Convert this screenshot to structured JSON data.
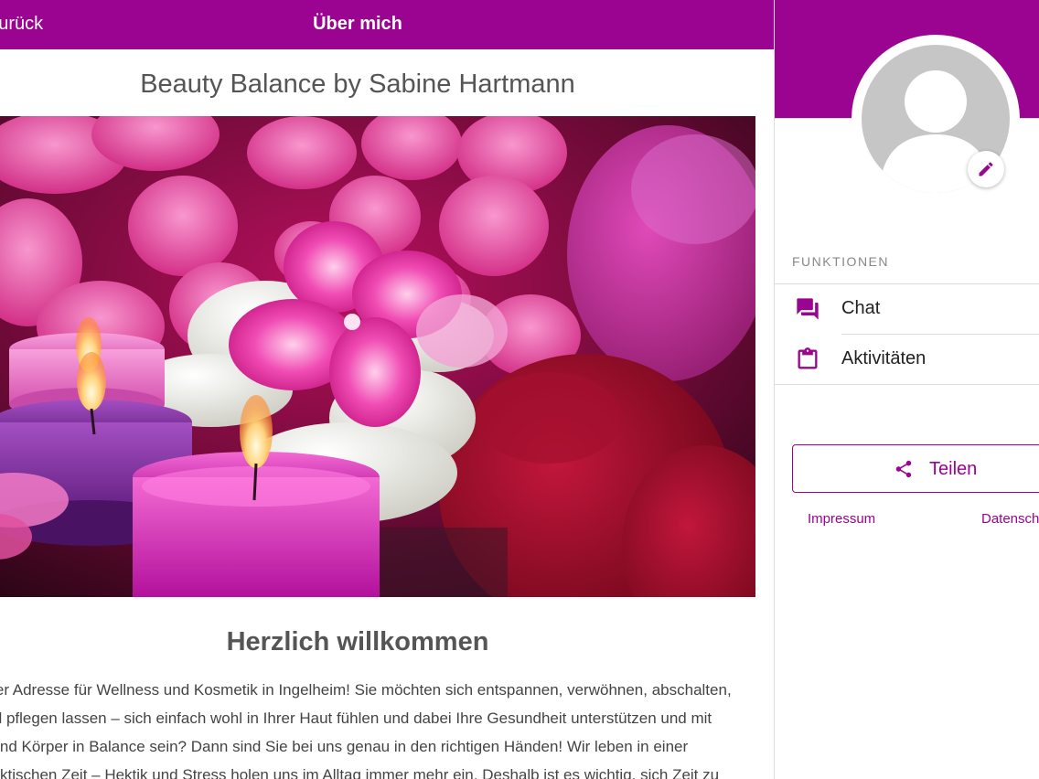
{
  "header": {
    "back_label": "Zurück",
    "title": "Über mich"
  },
  "main": {
    "page_title": "Beauty Balance by Sabine Hartmann",
    "welcome_heading": "Herzlich willkommen",
    "body_lines": [
      "Willkommen bei Ihrer Adresse für Wellness und Kosmetik in Ingelheim! Sie möchten sich entspannen, verwöhnen, abschalten,",
      "sich professionell pflegen lassen – sich einfach wohl in Ihrer Haut fühlen und dabei Ihre Gesundheit unterstützen und mit",
      "Ihrem Geist und Körper in Balance sein? Dann sind Sie bei uns genau in den richtigen Händen! Wir leben in einer",
      "schnelllebigen, hektischen Zeit – Hektik und Stress holen uns im Alltag immer mehr ein. Deshalb ist es wichtig, sich Zeit zu"
    ],
    "hero_image": "spa-candles-flowers-image"
  },
  "sidebar": {
    "avatar_icon": "person-placeholder-icon",
    "edit_icon": "pencil-icon",
    "section_label": "FUNKTIONEN",
    "items": [
      {
        "label": "Chat",
        "icon": "chat-icon"
      },
      {
        "label": "Aktivitäten",
        "icon": "clipboard-icon"
      }
    ],
    "share_label": "Teilen",
    "share_icon": "share-icon",
    "links": [
      "Impressum",
      "Datenschutz"
    ]
  },
  "colors": {
    "accent": "#9b0391",
    "text": "#333333",
    "muted": "#888888"
  }
}
